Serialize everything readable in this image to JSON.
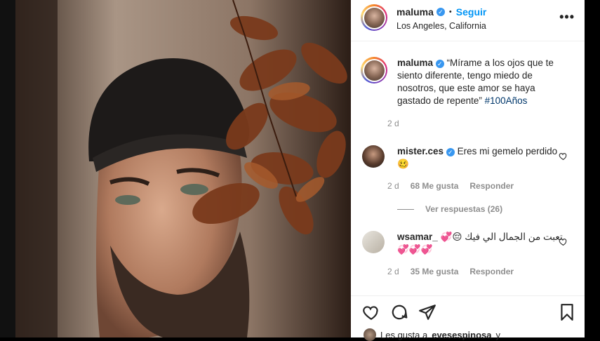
{
  "post": {
    "username": "maluma",
    "follow_label": "Seguir",
    "location": "Los Angeles, California",
    "more_label": "•••",
    "separator": "•"
  },
  "caption": {
    "username": "maluma",
    "text": "“Mírame a los ojos que te siento diferente, tengo miedo de nosotros, que este amor se haya gastado de repente” ",
    "hashtag": "#100Años",
    "time": "2 d"
  },
  "comments": [
    {
      "username": "mister.ces",
      "text": "Eres mi gemelo perdido🥴",
      "time": "2 d",
      "likes": "68 Me gusta",
      "reply_label": "Responder",
      "view_replies": "Ver respuestas (26)"
    },
    {
      "username": "wsamar_",
      "text": "تعبت من الجمال الي فيك 😔💞",
      "text2": "💞💞💞",
      "time": "2 d",
      "likes": "35 Me gusta",
      "reply_label": "Responder"
    }
  ],
  "likes_line": {
    "prefix": "Les gusta a",
    "user": "evesespinosa",
    "suffix": "y"
  },
  "colors": {
    "link_blue": "#0095f6",
    "verified_blue": "#3897f0",
    "hashtag": "#00376b",
    "secondary_text": "#8e8e8e"
  },
  "icons": [
    "verified-badge-icon",
    "more-options-icon",
    "heart-icon",
    "comment-icon",
    "share-icon",
    "bookmark-icon"
  ]
}
